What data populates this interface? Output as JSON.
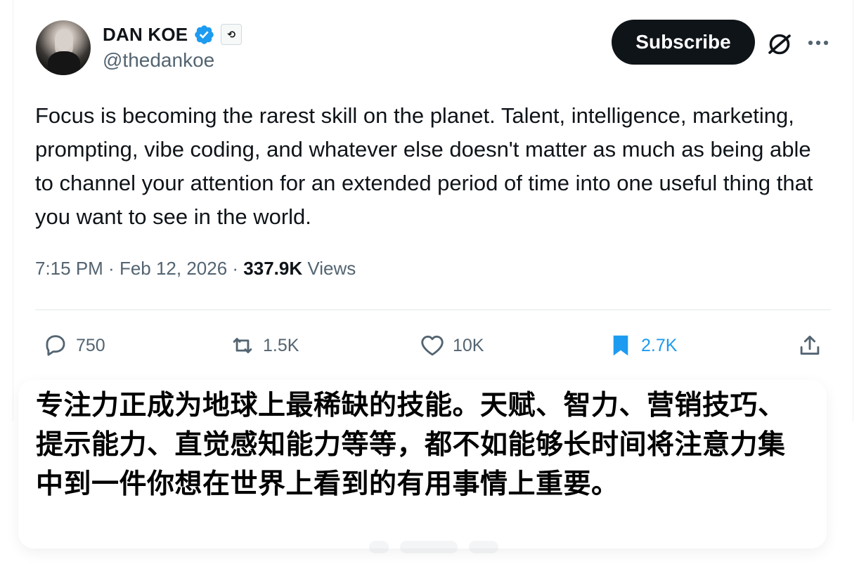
{
  "tweet": {
    "author_name": "DAN KOE",
    "handle": "@thedankoe",
    "subscribe_label": "Subscribe",
    "affiliate_badge": "⟲",
    "text": "Focus is becoming the rarest skill on the planet. Talent, intelligence, marketing, prompting, vibe coding, and whatever else doesn't matter as much as being able to channel your attention for an extended period of time into one useful thing that you want to see in the world.",
    "time": "7:15 PM",
    "separator": " · ",
    "date": "Feb 12, 2026",
    "views_count": "337.9K",
    "views_label": "Views"
  },
  "actions": {
    "reply_count": "750",
    "retweet_count": "1.5K",
    "like_count": "10K",
    "bookmark_count": "2.7K"
  },
  "translation": {
    "text": "专注力正成为地球上最稀缺的技能。天赋、智力、营销技巧、提示能力、直觉感知能力等等，都不如能够长时间将注意力集中到一件你想在世界上看到的有用事情上重要。"
  },
  "icons": {
    "verified": "verified-badge-icon",
    "affiliate": "affiliate-badge-icon",
    "grok": "grok-icon",
    "more": "more-icon",
    "reply": "reply-icon",
    "retweet": "retweet-icon",
    "like": "heart-icon",
    "bookmark": "bookmark-icon",
    "share": "share-icon"
  },
  "colors": {
    "brand": "#1d9bf0",
    "text": "#0f1419",
    "muted": "#536471"
  }
}
